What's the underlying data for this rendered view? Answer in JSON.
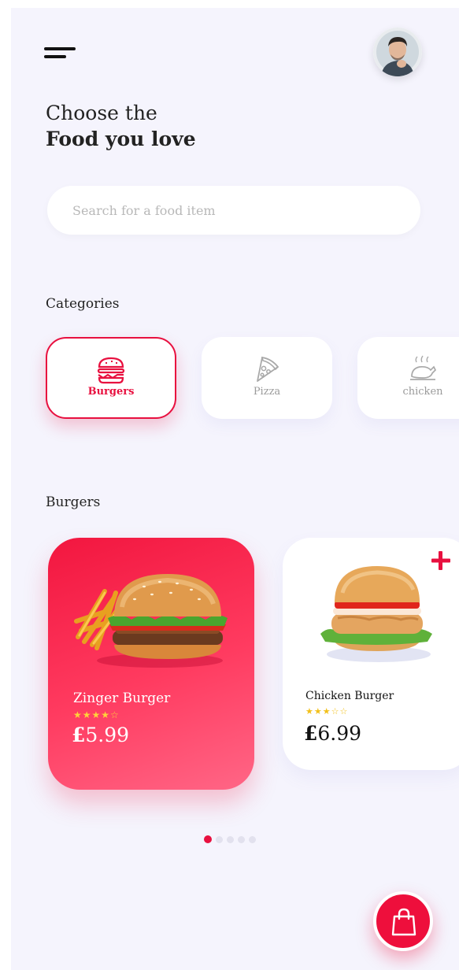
{
  "header": {
    "greeting_line1": "Choose the",
    "greeting_line2": "Food you love"
  },
  "search": {
    "placeholder": "Search for a food item",
    "value": ""
  },
  "categories": {
    "title": "Categories",
    "items": [
      {
        "label": "Burgers",
        "icon": "burger-icon",
        "selected": true
      },
      {
        "label": "Pizza",
        "icon": "pizza-icon",
        "selected": false
      },
      {
        "label": "chicken",
        "icon": "chicken-icon",
        "selected": false
      }
    ]
  },
  "products": {
    "title": "Burgers",
    "items": [
      {
        "name": "Zinger Burger",
        "rating": 4,
        "max_rating": 5,
        "currency": "£",
        "amount": "5.99",
        "featured": true
      },
      {
        "name": "Chicken Burger",
        "rating": 3,
        "max_rating": 5,
        "currency": "£",
        "amount": "6.99",
        "featured": false
      }
    ]
  },
  "pagination": {
    "total": 5,
    "active": 1
  },
  "theme": {
    "accent": "#e8103f",
    "background": "#f5f4fd",
    "star_color": "#ffd23a"
  }
}
